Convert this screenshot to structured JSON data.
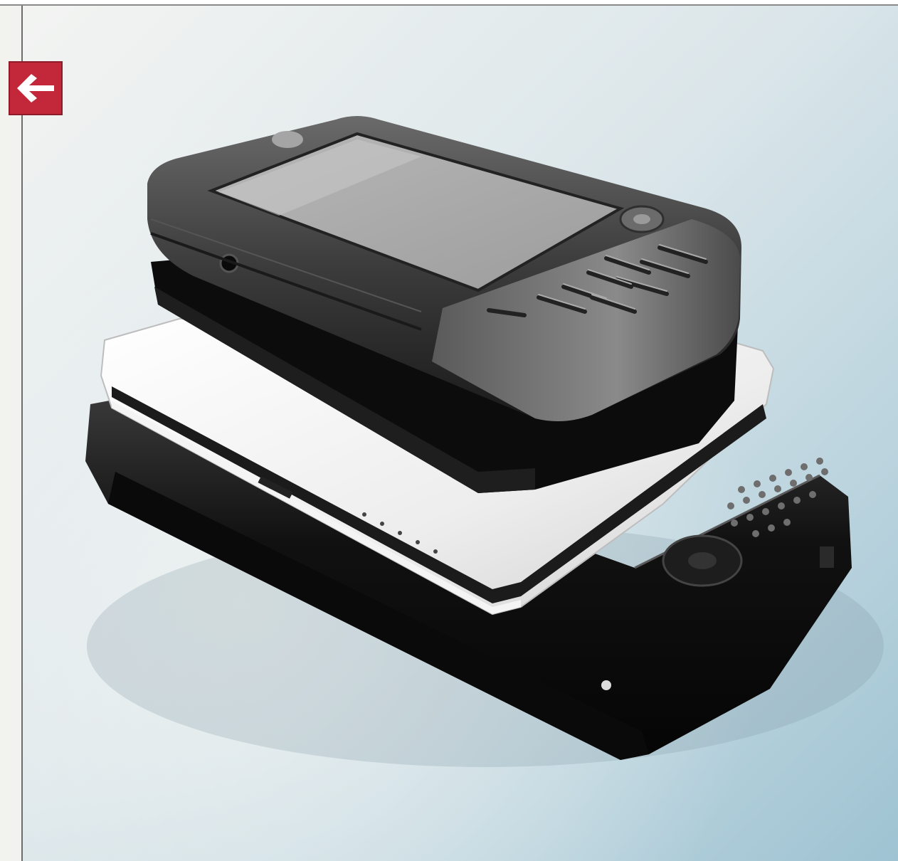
{
  "navigation": {
    "back_icon": "arrow-left-icon",
    "back_color": "#c3283a"
  },
  "photo": {
    "subject": "stacked-handheld-devices-photo",
    "background_tint": "#b9d4df"
  }
}
